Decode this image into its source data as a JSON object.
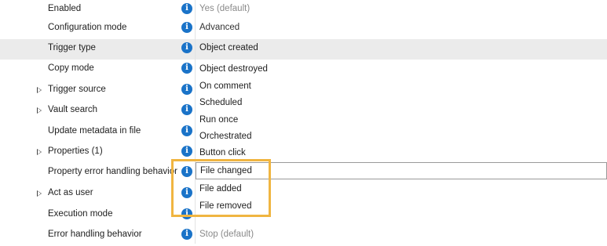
{
  "info_glyph": "i",
  "rows": [
    {
      "label": "Enabled",
      "value": "Yes (default)"
    },
    {
      "label": "Configuration mode",
      "value": "Advanced"
    },
    {
      "label": "Trigger type",
      "value": "Object created"
    },
    {
      "label": "Copy mode",
      "value": ""
    },
    {
      "label": "Trigger source",
      "value": ""
    },
    {
      "label": "Vault search",
      "value": ""
    },
    {
      "label": "Update metadata in file",
      "value": ""
    },
    {
      "label": "Properties (1)",
      "value": ""
    },
    {
      "label": "Property error handling behavior",
      "value": ""
    },
    {
      "label": "Act as user",
      "value": ""
    },
    {
      "label": "Execution mode",
      "value": ""
    },
    {
      "label": "Error handling behavior",
      "value": "Stop (default)"
    }
  ],
  "dropdown": {
    "options": [
      "Object destroyed",
      "On comment",
      "Scheduled",
      "Run once",
      "Orchestrated",
      "Button click",
      "File changed",
      "File added",
      "File removed"
    ]
  },
  "colors": {
    "info": "#1a73c8",
    "highlight": "#f0b541",
    "selected_row": "#ebebeb"
  }
}
